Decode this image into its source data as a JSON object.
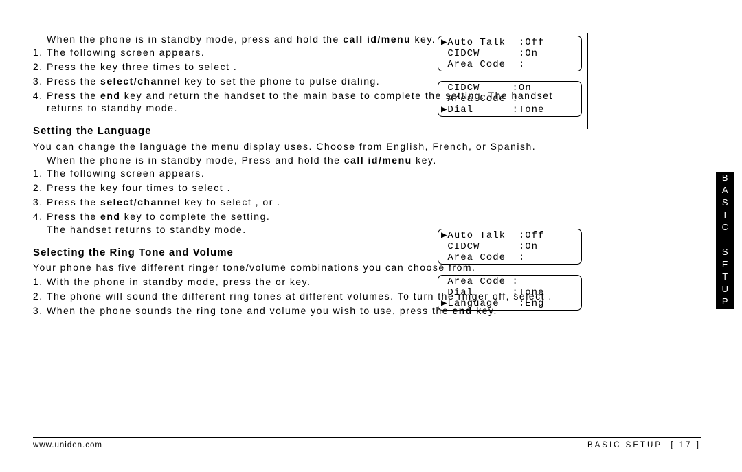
{
  "section1": {
    "steps": [
      {
        "pre": "When the phone is in standby mode, press and hold the ",
        "key": "call id/menu",
        "post": " key. The following screen appears."
      },
      {
        "pre": "Press the     key three times to select          ."
      },
      {
        "pre": "Press the ",
        "key": "select/channel",
        "post": " key to set the phone to pulse dialing."
      },
      {
        "pre": "Press the ",
        "key": "end",
        "post": " key and return the handset to the main base to complete the setting. The handset returns to standby mode."
      }
    ]
  },
  "section2": {
    "heading": "Setting the Language",
    "intro": "You can change the language the menu display uses. Choose from English, French, or Spanish.",
    "steps": [
      {
        "pre": "When the phone is in standby mode, Press and hold the ",
        "key": "call id/menu",
        "post": " key. The following screen appears."
      },
      {
        "pre": "Press the     key four times to select               ."
      },
      {
        "pre": "Press the ",
        "key": "select/channel",
        "post": " key to select      ,       or     ."
      },
      {
        "pre": "Press the ",
        "key": "end",
        "post": " key to complete the setting.",
        "extra": "The handset returns to standby mode."
      }
    ]
  },
  "section3": {
    "heading": "Selecting the Ring Tone and Volume",
    "intro": "Your phone has five different ringer tone/volume combinations you can choose from.",
    "steps": [
      {
        "pre": "With the phone in standby mode, press the      or      key."
      },
      {
        "pre": "The phone will sound the different ring tones at different volumes. To turn the ringer off, select              ."
      },
      {
        "pre": "When the phone sounds the ring tone and volume you wish to use, press the ",
        "key": "end",
        "post": " key."
      }
    ]
  },
  "lcd": {
    "l1": "▶Auto Talk  :Off\n CIDCW      :On\n Area Code  :",
    "l2": " CIDCW     :On\n Area Code :\n▶Dial      :Tone",
    "l3": "▶Auto Talk  :Off\n CIDCW      :On\n Area Code  :",
    "l4": " Area Code :\n Dial      :Tone\n▶Language   :Eng"
  },
  "sidetab": "BASIC SETUP",
  "footer": {
    "url": "www.uniden.com",
    "section": "BASIC SETUP",
    "page": "[ 17 ]"
  }
}
